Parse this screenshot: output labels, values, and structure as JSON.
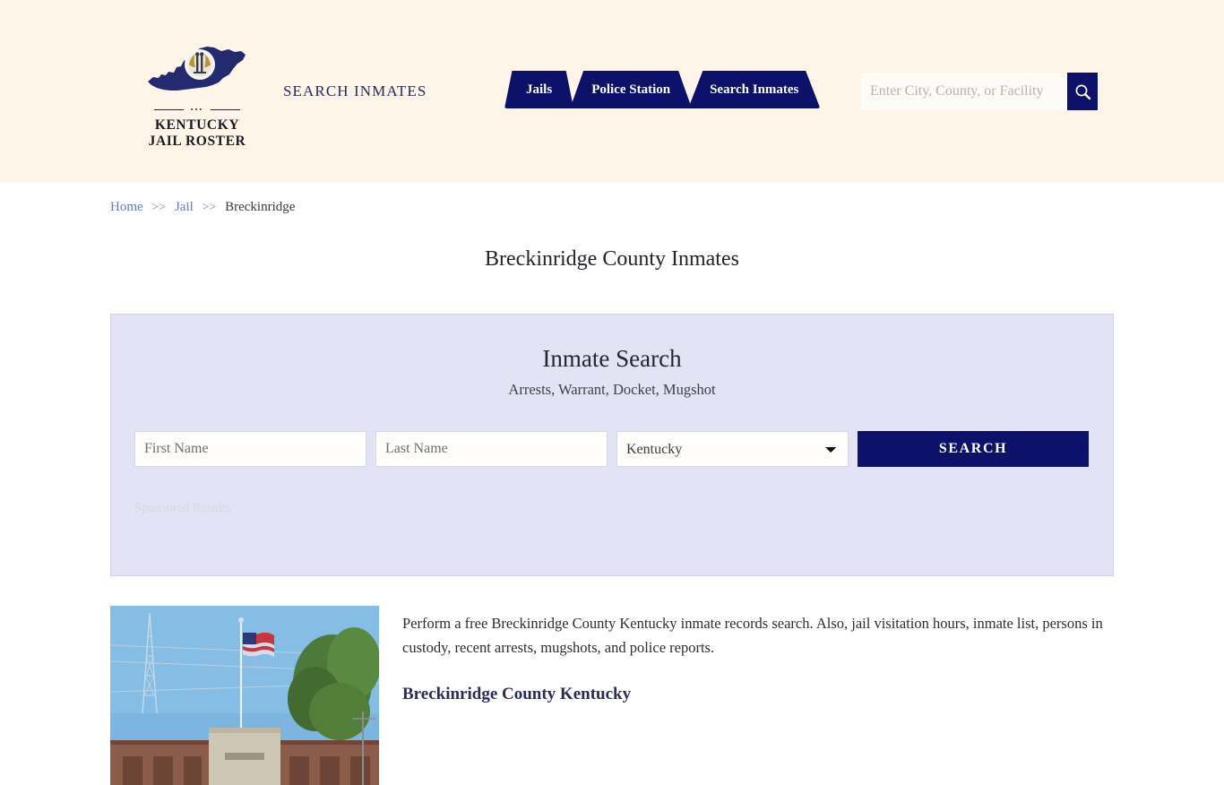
{
  "header": {
    "brand": {
      "line1": "KENTUCKY",
      "line2": "JAIL ROSTER",
      "dots": "•••"
    },
    "tagline": "SEARCH INMATES",
    "nav": [
      {
        "label": "Jails",
        "name": "nav-tab-jails"
      },
      {
        "label": "Police Station",
        "name": "nav-tab-police-station"
      },
      {
        "label": "Search Inmates",
        "name": "nav-tab-search-inmates"
      }
    ],
    "search": {
      "placeholder": "Enter City, County, or Facility",
      "value": "",
      "button_icon": "search-icon"
    },
    "background_color": "#FDF6E8",
    "accent_color": "#0D1169"
  },
  "breadcrumb": {
    "items": [
      {
        "label": "Home",
        "link": true
      },
      {
        "label": "Jail",
        "link": true
      },
      {
        "label": "Breckinridge",
        "link": false
      }
    ],
    "separator": ">>"
  },
  "page": {
    "title": "Breckinridge County Inmates"
  },
  "search_panel": {
    "title": "Inmate Search",
    "subtitle": "Arrests, Warrant, Docket, Mugshot",
    "first_name": {
      "placeholder": "First Name",
      "value": ""
    },
    "last_name": {
      "placeholder": "Last Name",
      "value": ""
    },
    "state": {
      "selected": "Kentucky",
      "options": [
        "Kentucky"
      ]
    },
    "search_button": "SEARCH",
    "sponsored_label": "Sponsored Results",
    "background_color": "#E2E3F4"
  },
  "lower": {
    "photo_alt": "breckinridge-county-jail-photo",
    "paragraph": "Perform a free Breckinridge County Kentucky inmate records search. Also, jail visitation hours, inmate list, persons in custody, recent arrests, mugshots, and police reports.",
    "sub_heading": "Breckinridge County Kentucky"
  }
}
